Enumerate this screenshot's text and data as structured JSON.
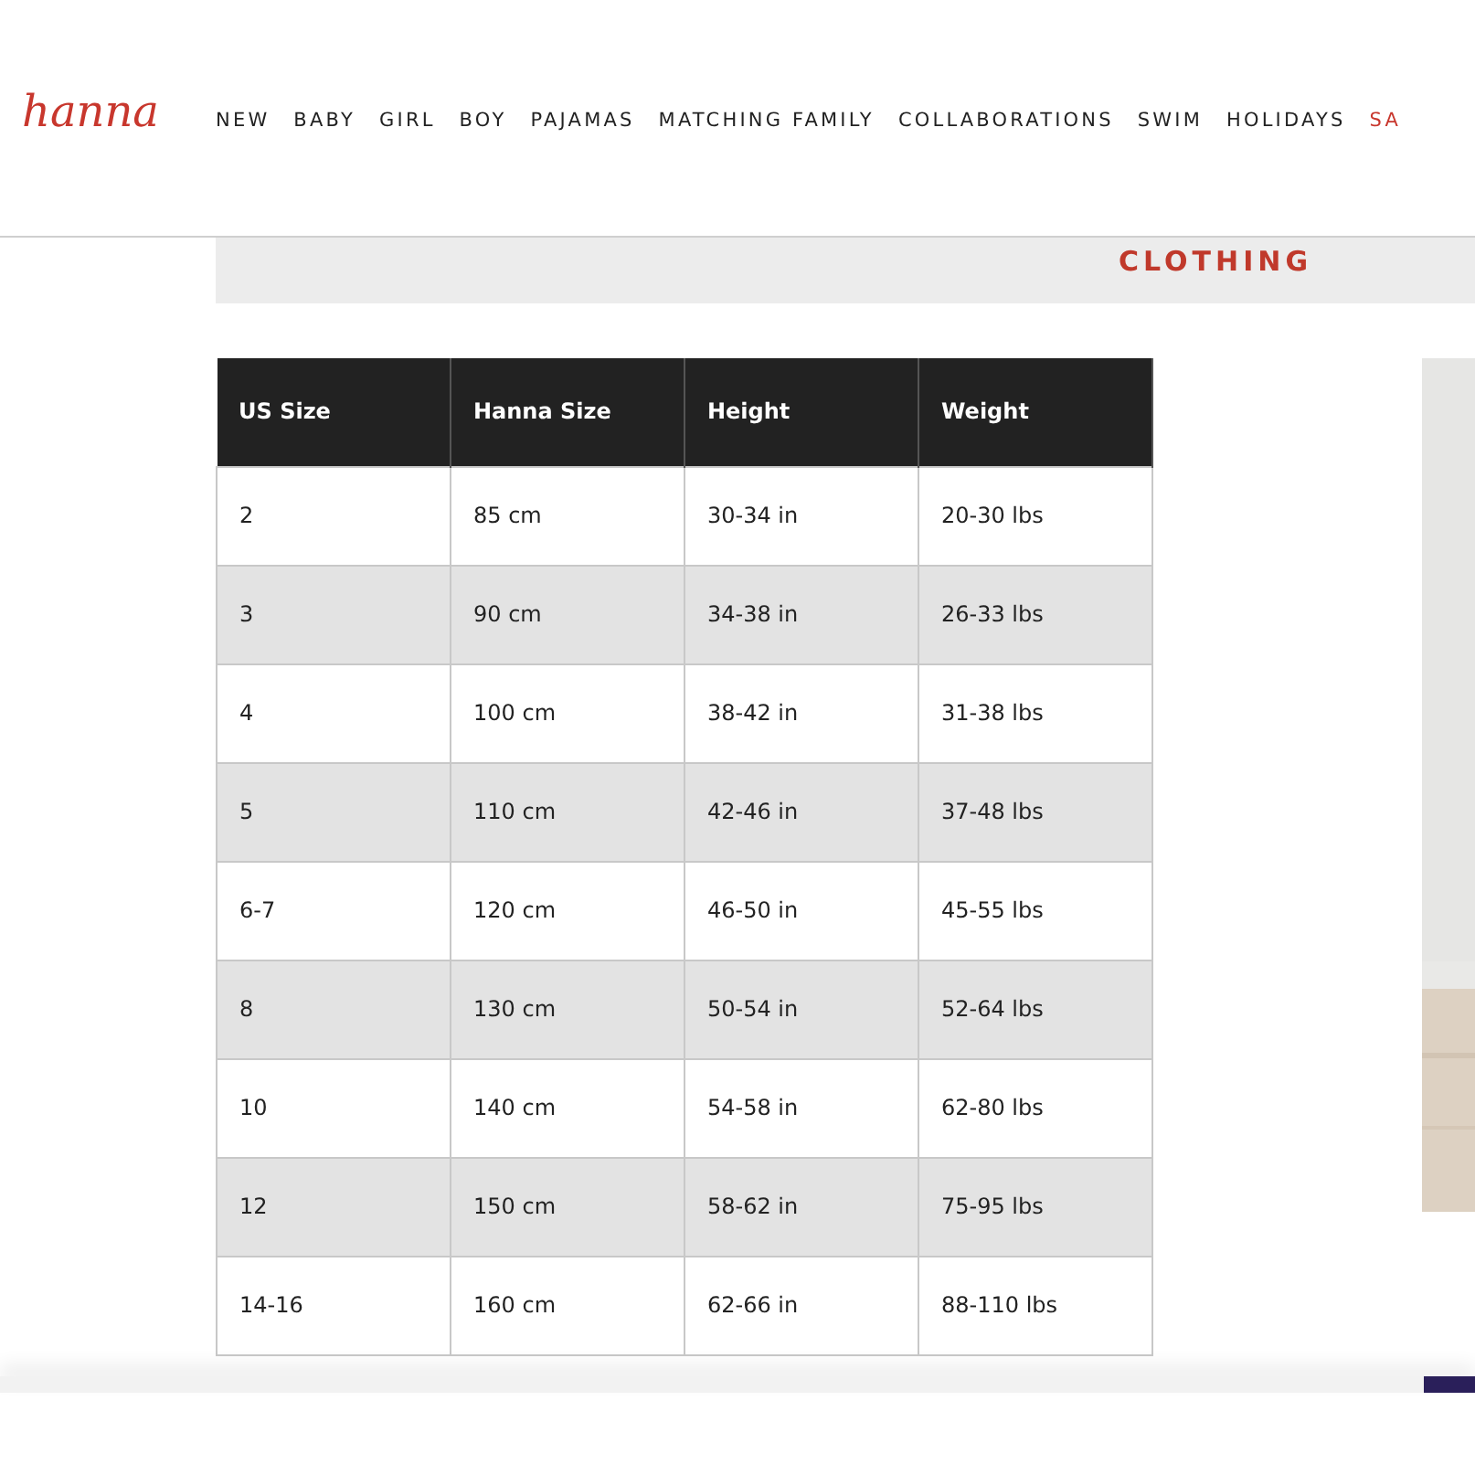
{
  "logo": "hanna",
  "nav": [
    {
      "label": "NEW",
      "kind": "normal"
    },
    {
      "label": "BABY",
      "kind": "normal"
    },
    {
      "label": "GIRL",
      "kind": "normal"
    },
    {
      "label": "BOY",
      "kind": "normal"
    },
    {
      "label": "PAJAMAS",
      "kind": "normal"
    },
    {
      "label": "MATCHING FAMILY",
      "kind": "normal"
    },
    {
      "label": "COLLABORATIONS",
      "kind": "normal"
    },
    {
      "label": "SWIM",
      "kind": "normal"
    },
    {
      "label": "HOLIDAYS",
      "kind": "normal"
    },
    {
      "label": "SA",
      "kind": "sale"
    }
  ],
  "banner": {
    "title": "CLOTHING"
  },
  "table": {
    "columns": [
      "US Size",
      "Hanna Size",
      "Height",
      "Weight"
    ],
    "rows": [
      [
        "2",
        "85 cm",
        "30-34 in",
        "20-30 lbs"
      ],
      [
        "3",
        "90 cm",
        "34-38 in",
        "26-33 lbs"
      ],
      [
        "4",
        "100 cm",
        "38-42 in",
        "31-38 lbs"
      ],
      [
        "5",
        "110 cm",
        "42-46 in",
        "37-48 lbs"
      ],
      [
        "6-7",
        "120 cm",
        "46-50 in",
        "45-55 lbs"
      ],
      [
        "8",
        "130 cm",
        "50-54 in",
        "52-64 lbs"
      ],
      [
        "10",
        "140 cm",
        "54-58 in",
        "62-80 lbs"
      ],
      [
        "12",
        "150 cm",
        "58-62 in",
        "75-95 lbs"
      ],
      [
        "14-16",
        "160 cm",
        "62-66 in",
        "88-110 lbs"
      ]
    ]
  }
}
